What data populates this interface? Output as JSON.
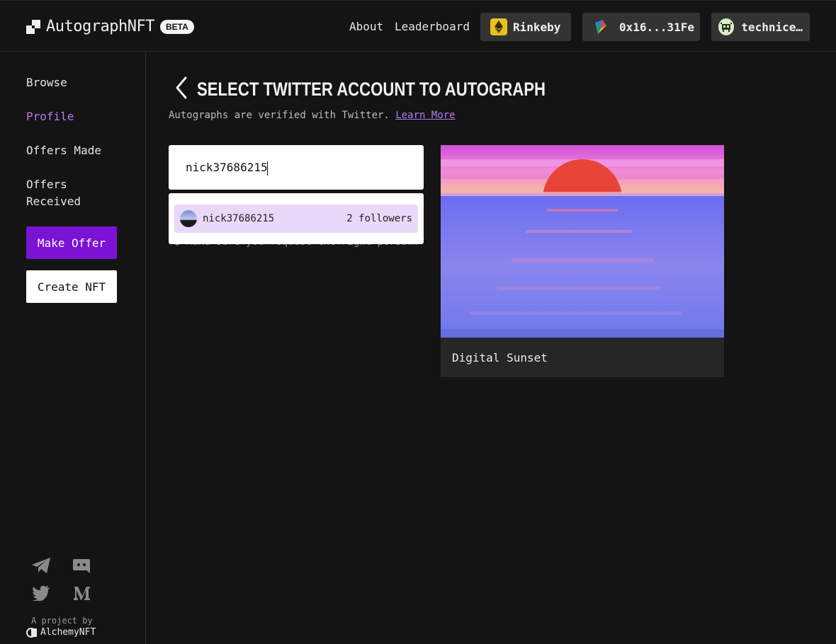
{
  "app": {
    "name": "AutographNFT",
    "badge": "BETA"
  },
  "header": {
    "nav": [
      "About",
      "Leaderboard"
    ],
    "network": "Rinkeby",
    "wallet": "0x16...31Fe",
    "user": "technice…"
  },
  "sidebar": {
    "items": [
      "Browse",
      "Profile",
      "Offers Made",
      "Offers Received"
    ],
    "active": "Profile",
    "make_offer": "Make Offer",
    "create_nft": "Create NFT",
    "project_by": "A project by",
    "project_name": "AlchemyNFT",
    "social_icons": [
      "telegram-icon",
      "discord-icon",
      "twitter-icon",
      "medium-icon"
    ]
  },
  "main": {
    "title": "SELECT TWITTER ACCOUNT TO AUTOGRAPH",
    "subtitle": "Autographs are verified with Twitter.",
    "learn_more": "Learn More",
    "search": {
      "value": "nick37686215"
    },
    "hint": "Make sure you request the right person.",
    "results": [
      {
        "name": "nick37686215",
        "followers": "2 followers"
      }
    ],
    "nft": {
      "title": "Digital Sunset"
    }
  },
  "colors": {
    "accent": "#7b12d4",
    "accent_text": "#b27cf0",
    "bg": "#141414"
  }
}
